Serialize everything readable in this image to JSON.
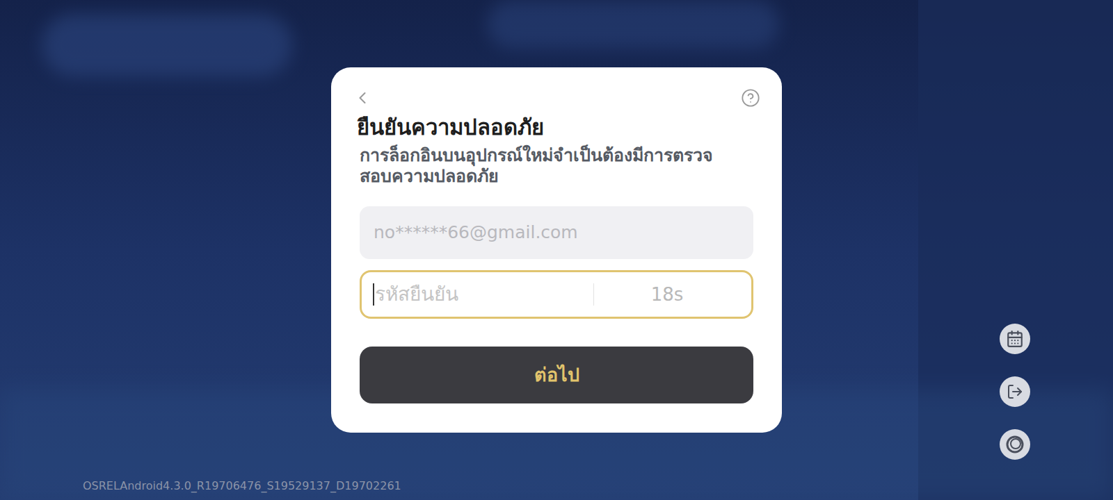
{
  "version": "OSRELAndroid4.3.0_R19706476_S19529137_D19702261",
  "dialog": {
    "title": "ยืนยันความปลอดภัย",
    "subtitle": "การล็อกอินบนอุปกรณ์ใหม่จำเป็นต้องมีการตรวจสอบความปลอดภัย",
    "email": {
      "value": "no******66@gmail.com",
      "disabled": true
    },
    "code": {
      "placeholder": "รหัสยืนยัน",
      "countdown": "18s",
      "focused": true
    },
    "button": "ต่อไป"
  }
}
